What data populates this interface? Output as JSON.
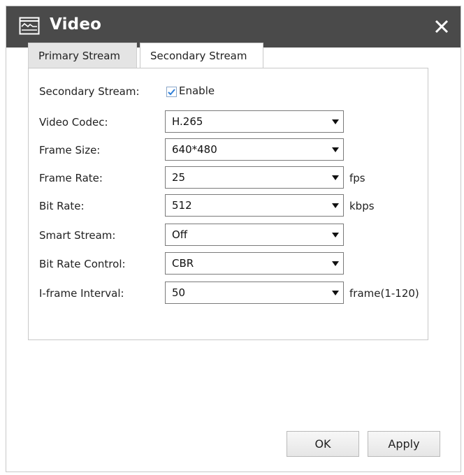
{
  "dialog": {
    "title": "Video",
    "icons": {
      "title": "video-stream-icon",
      "close": "close-icon"
    }
  },
  "tabs": [
    {
      "label": "Primary Stream",
      "active": false
    },
    {
      "label": "Secondary Stream",
      "active": true
    }
  ],
  "form": {
    "secondary_stream": {
      "label": "Secondary Stream:",
      "checkbox_label": "Enable",
      "checked": true
    },
    "video_codec": {
      "label": "Video Codec:",
      "value": "H.265"
    },
    "frame_size": {
      "label": "Frame Size:",
      "value": "640*480"
    },
    "frame_rate": {
      "label": "Frame Rate:",
      "value": "25",
      "unit": "fps"
    },
    "bit_rate": {
      "label": "Bit Rate:",
      "value": "512",
      "unit": "kbps"
    },
    "smart_stream": {
      "label": "Smart Stream:",
      "value": "Off"
    },
    "bit_rate_control": {
      "label": "Bit Rate Control:",
      "value": "CBR"
    },
    "iframe_interval": {
      "label": "I-frame Interval:",
      "value": "50",
      "unit": "frame(1-120)"
    }
  },
  "buttons": {
    "ok": "OK",
    "apply": "Apply"
  },
  "colors": {
    "titlebar": "#4a4a4a",
    "checkmark": "#2f7fd8"
  }
}
